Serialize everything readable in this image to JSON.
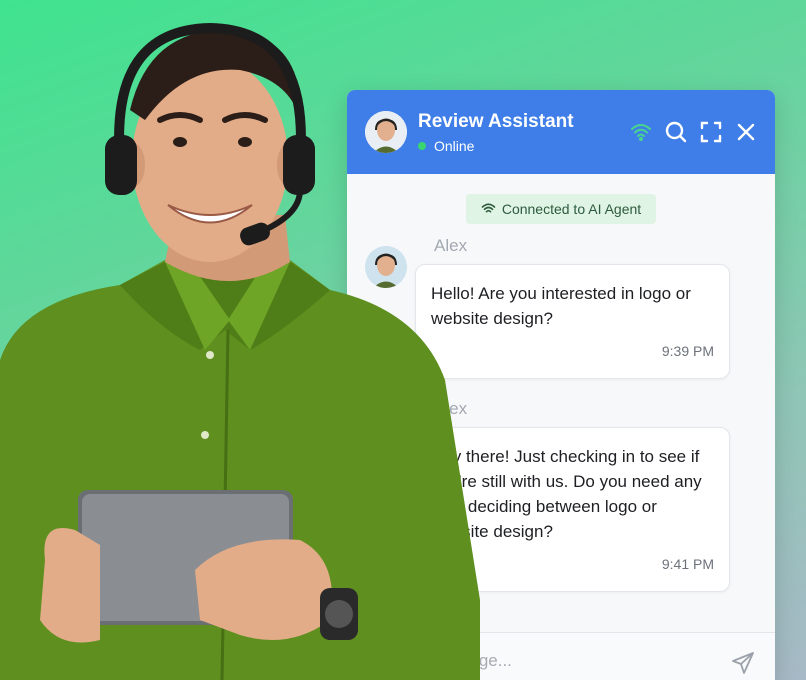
{
  "chat": {
    "title": "Review Assistant",
    "status": "Online",
    "connected_label": "Connected to AI Agent",
    "messages": [
      {
        "sender": "Alex",
        "text": "Hello! Are you interested in logo or website design?",
        "time": "9:39 PM"
      },
      {
        "sender": "Alex",
        "text": "Hey there! Just checking in to see if you're still with us. Do you need any help deciding between logo or website design?",
        "time": "9:41 PM"
      }
    ],
    "input_placeholder": "Type a message..."
  },
  "colors": {
    "header": "#3f7ee8",
    "online": "#39d66f",
    "connected_bg": "#dff4e5",
    "wifi_icon": "#49d68c"
  },
  "icons": [
    "wifi-icon",
    "search-icon",
    "fullscreen-icon",
    "close-icon",
    "send-icon"
  ]
}
